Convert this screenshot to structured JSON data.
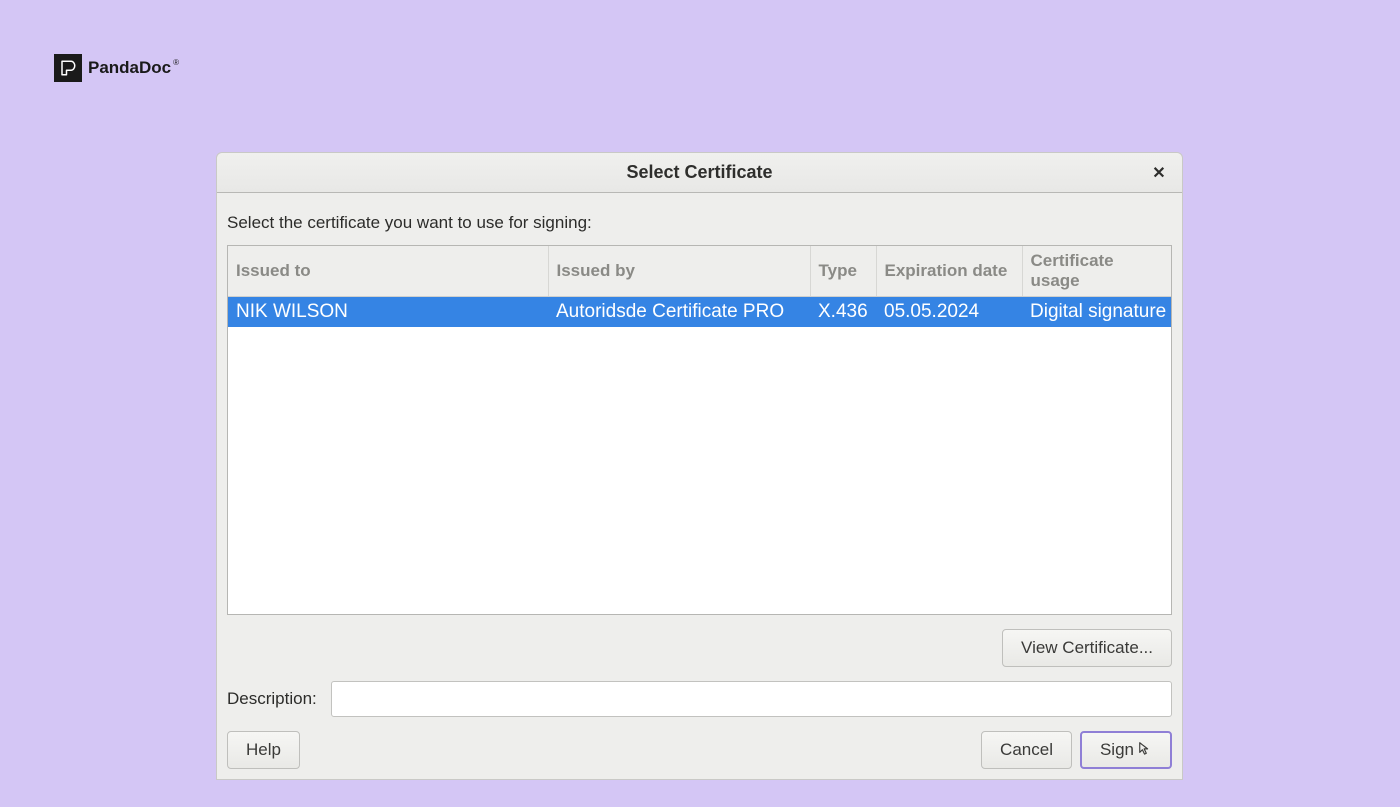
{
  "brand": {
    "name": "PandaDoc"
  },
  "dialog": {
    "title": "Select Certificate",
    "instruction": "Select the certificate you want to use for signing:",
    "columns": {
      "issued_to": "Issued to",
      "issued_by": "Issued by",
      "type": "Type",
      "expiration": "Expiration date",
      "usage": "Certificate usage"
    },
    "rows": [
      {
        "issued_to": "NIK WILSON",
        "issued_by": "Autoridsde Certificate PRO",
        "type": "X.436",
        "expiration": "05.05.2024",
        "usage": "Digital signature"
      }
    ],
    "buttons": {
      "view_certificate": "View Certificate...",
      "help": "Help",
      "cancel": "Cancel",
      "sign": "Sign"
    },
    "description_label": "Description:",
    "description_value": ""
  }
}
